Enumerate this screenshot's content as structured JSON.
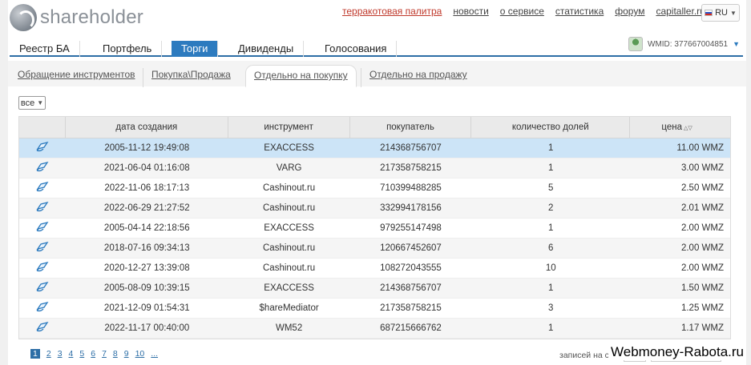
{
  "brand": {
    "name": "shareholder"
  },
  "toplinks": [
    {
      "label": "терракотовая палитра",
      "accent": true
    },
    {
      "label": "новости"
    },
    {
      "label": "о сервисе"
    },
    {
      "label": "статистика"
    },
    {
      "label": "форум"
    },
    {
      "label": "capitaller.ru"
    }
  ],
  "language": {
    "value": "RU"
  },
  "mainnav": [
    {
      "label": "Реестр БА"
    },
    {
      "label": "Портфель"
    },
    {
      "label": "Торги",
      "active": true
    },
    {
      "label": "Дивиденды"
    },
    {
      "label": "Голосования"
    }
  ],
  "user": {
    "wmid": "WMID: 377667004851"
  },
  "subtabs": [
    {
      "label": "Обращение инструментов"
    },
    {
      "label": "Покупка\\Продажа"
    },
    {
      "label": "Отдельно на покупку",
      "active": true
    },
    {
      "label": "Отдельно на продажу"
    }
  ],
  "filter": {
    "value": "все"
  },
  "table": {
    "headers": [
      "",
      "дата создания",
      "инструмент",
      "покупатель",
      "количество долей",
      "цена"
    ],
    "sort_icon": "sort-arrows-icon",
    "rows": [
      [
        "2005-11-12 19:49:08",
        "EXACCESS",
        "214368756707",
        "1",
        "11.00 WMZ"
      ],
      [
        "2021-06-04 01:16:08",
        "VARG",
        "217358758215",
        "1",
        "3.00 WMZ"
      ],
      [
        "2022-11-06 18:17:13",
        "Cashinout.ru",
        "710399488285",
        "5",
        "2.50 WMZ"
      ],
      [
        "2022-06-29 21:27:52",
        "Cashinout.ru",
        "332994178156",
        "2",
        "2.01 WMZ"
      ],
      [
        "2005-04-14 22:18:56",
        "EXACCESS",
        "979255147498",
        "1",
        "2.00 WMZ"
      ],
      [
        "2018-07-16 09:34:13",
        "Cashinout.ru",
        "120667452607",
        "6",
        "2.00 WMZ"
      ],
      [
        "2020-12-27 13:39:08",
        "Cashinout.ru",
        "108272043555",
        "10",
        "2.00 WMZ"
      ],
      [
        "2005-08-09 10:39:15",
        "EXACCESS",
        "214368756707",
        "1",
        "1.50 WMZ"
      ],
      [
        "2021-12-09 01:54:31",
        "$hareMediator",
        "217358758215",
        "3",
        "1.25 WMZ"
      ],
      [
        "2022-11-17 00:40:00",
        "WM52",
        "687215666762",
        "1",
        "1.17 WMZ"
      ]
    ]
  },
  "pager": {
    "pages": [
      "1",
      "2",
      "3",
      "4",
      "5",
      "6",
      "7",
      "8",
      "9",
      "10",
      "..."
    ],
    "current": "1",
    "perpage_label": "записей на стр.:"
  },
  "watermark": "Webmoney-Rabota.ru",
  "colors": {
    "accent": "#2d7bbf",
    "selected_row": "#cce4f7",
    "link_accent": "#c0392b"
  }
}
